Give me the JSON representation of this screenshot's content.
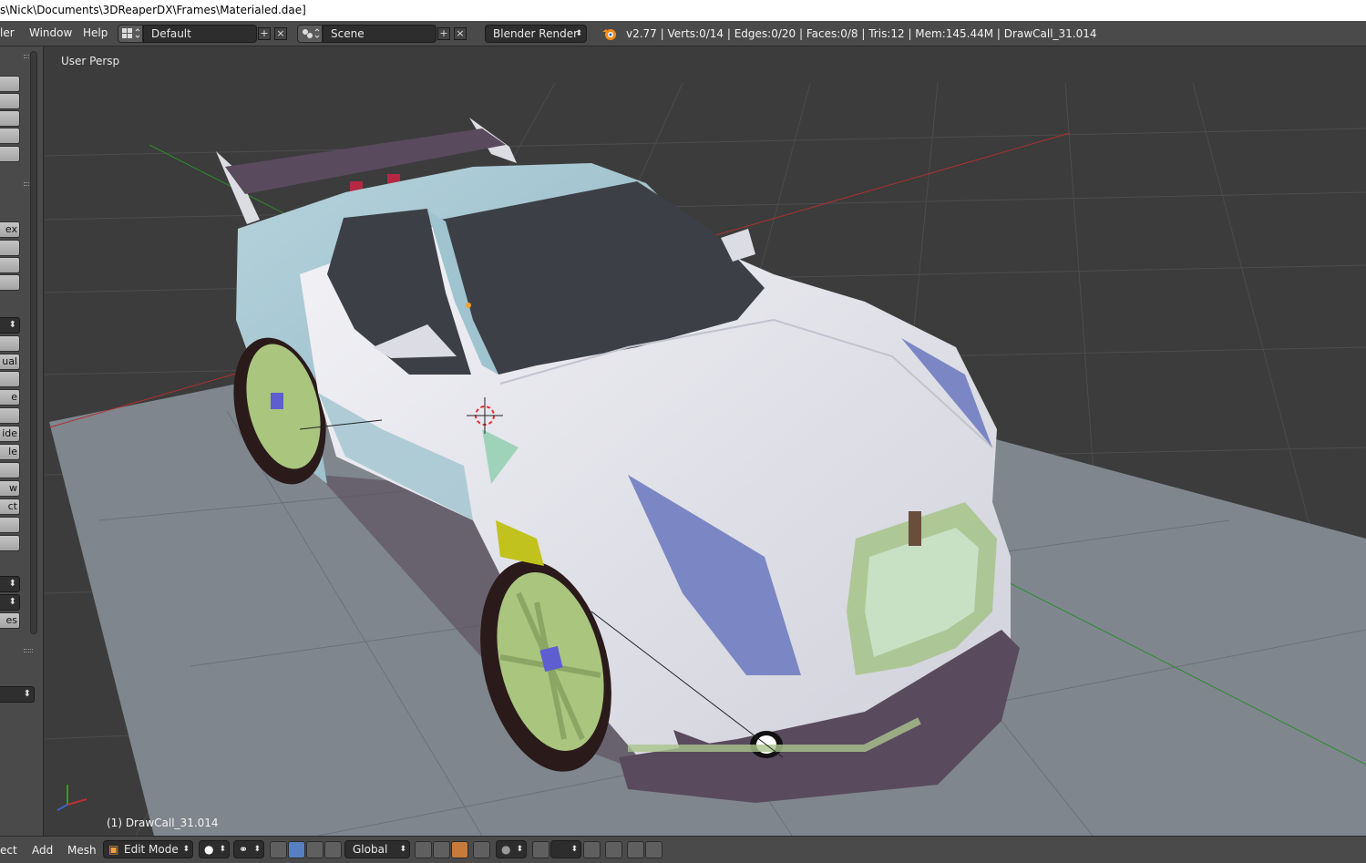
{
  "title_bar": {
    "path": "s\\Nick\\Documents\\3DReaperDX\\Frames\\Materialed.dae]"
  },
  "menu": {
    "render": "ler",
    "window": "Window",
    "help": "Help"
  },
  "screen_layout": {
    "value": "Default"
  },
  "scene": {
    "value": "Scene"
  },
  "render_engine": {
    "value": "Blender Render"
  },
  "stats": {
    "text": "v2.77 | Verts:0/14 | Edges:0/20 | Faces:0/8 | Tris:12 | Mem:145.44M | DrawCall_31.014"
  },
  "tool_shelf": {
    "buttons": [
      "",
      "",
      "",
      "",
      "",
      "ex",
      "",
      "",
      "",
      "ual",
      "e",
      "",
      "ide",
      "le",
      "",
      "w",
      "ct",
      "",
      "",
      "",
      "es"
    ]
  },
  "viewport": {
    "label": "User Persp",
    "object_label": "(1) DrawCall_31.014"
  },
  "header": {
    "select": "ect",
    "add": "Add",
    "mesh": "Mesh",
    "mode": "Edit Mode",
    "orientation": "Global"
  },
  "colors": {
    "accent": "#5680c2",
    "background": "#393939",
    "panel": "#4a4a4a",
    "car_body": "#e4e4ea",
    "car_teal": "#9fc3cf",
    "rim": "#b0cc86"
  },
  "icons": [
    "blender-logo-icon",
    "editor-type-icon",
    "add-icon",
    "close-icon",
    "scene-icon",
    "viewport-shading-icon",
    "pivot-icon",
    "manipulator-icon",
    "axis-gizmo-icon",
    "3d-cursor-icon"
  ]
}
